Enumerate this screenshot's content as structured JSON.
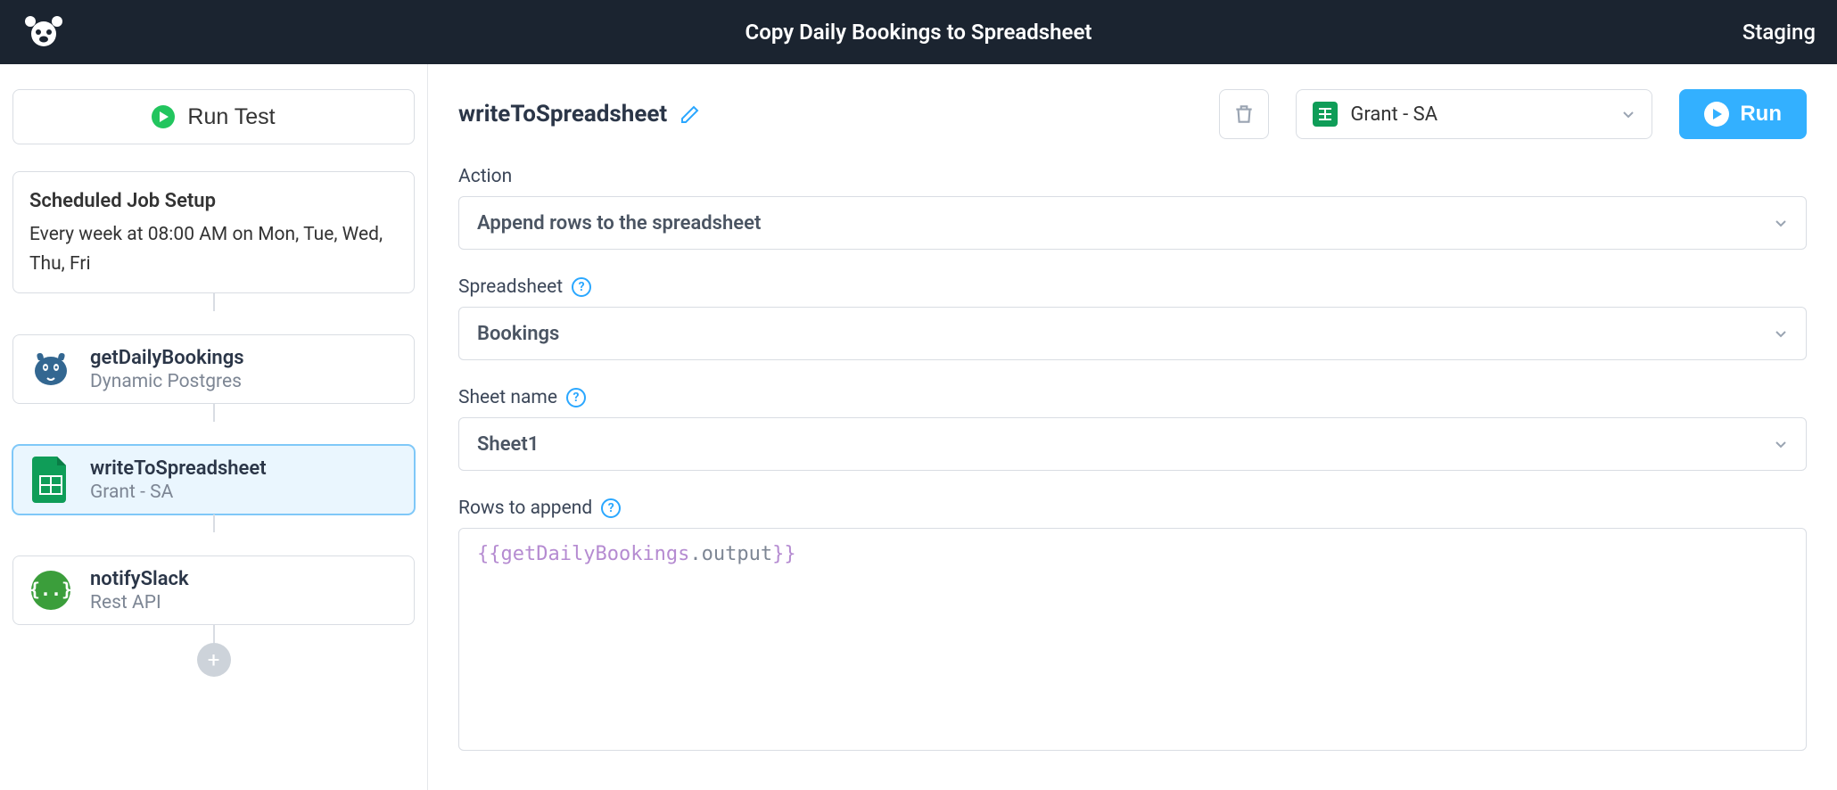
{
  "header": {
    "title": "Copy Daily Bookings to Spreadsheet",
    "env": "Staging"
  },
  "sidebar": {
    "run_test_label": "Run Test",
    "scheduled": {
      "title": "Scheduled Job Setup",
      "desc": "Every week at 08:00 AM on Mon, Tue, Wed, Thu, Fri"
    },
    "steps": [
      {
        "name": "getDailyBookings",
        "sub": "Dynamic Postgres",
        "icon": "postgres",
        "active": false
      },
      {
        "name": "writeToSpreadsheet",
        "sub": "Grant - SA",
        "icon": "sheets",
        "active": true
      },
      {
        "name": "notifySlack",
        "sub": "Rest API",
        "icon": "rest",
        "active": false
      }
    ]
  },
  "panel": {
    "title": "writeToSpreadsheet",
    "connection": "Grant - SA",
    "run_label": "Run",
    "fields": {
      "action": {
        "label": "Action",
        "value": "Append rows to the spreadsheet"
      },
      "spreadsheet": {
        "label": "Spreadsheet",
        "value": "Bookings"
      },
      "sheet": {
        "label": "Sheet name",
        "value": "Sheet1"
      },
      "rows": {
        "label": "Rows to append",
        "binding_open": "{{",
        "binding_name": "getDailyBookings",
        "binding_prop": ".output",
        "binding_close": "}}"
      }
    }
  }
}
